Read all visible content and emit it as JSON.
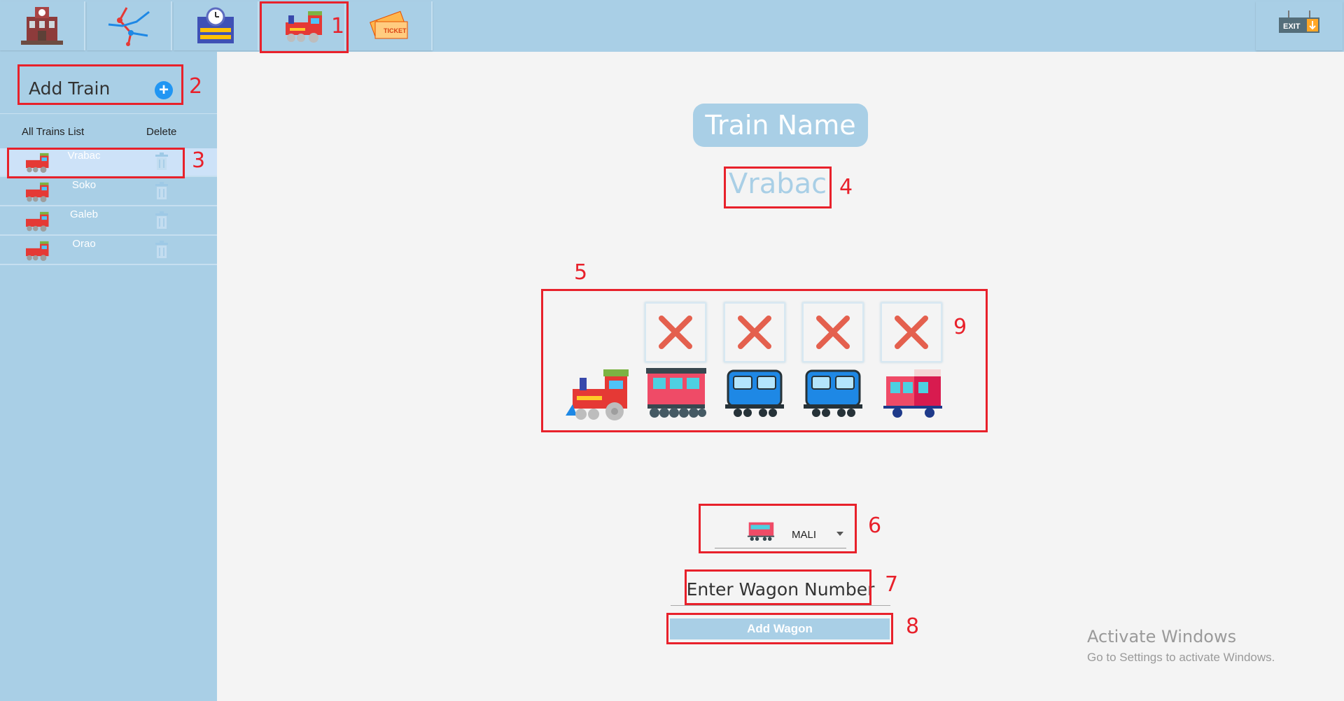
{
  "nav": {
    "tabs": [
      {
        "name": "station",
        "icon": "train-station-icon"
      },
      {
        "name": "lines",
        "icon": "route-map-icon"
      },
      {
        "name": "timetable",
        "icon": "timetable-clock-icon"
      },
      {
        "name": "trains",
        "icon": "locomotive-icon",
        "selected": true
      },
      {
        "name": "tickets",
        "icon": "ticket-icon"
      }
    ],
    "exit_label": "EXIT"
  },
  "sidebar": {
    "add_train_label": "Add Train",
    "list_header": "All Trains List",
    "delete_header": "Delete",
    "trains": [
      {
        "name": "Vrabac",
        "selected": true
      },
      {
        "name": "Soko"
      },
      {
        "name": "Galeb"
      },
      {
        "name": "Orao"
      }
    ]
  },
  "main": {
    "title": "Train Name",
    "train_name": "Vrabac",
    "composition": [
      {
        "type": "locomotive",
        "icon": "locomotive-icon"
      },
      {
        "type": "wagon",
        "icon": "red-passenger-wagon-icon",
        "remove_icon": "remove-x-icon"
      },
      {
        "type": "wagon",
        "icon": "blue-passenger-wagon-icon",
        "remove_icon": "remove-x-icon"
      },
      {
        "type": "wagon",
        "icon": "blue-passenger-wagon-icon",
        "remove_icon": "remove-x-icon"
      },
      {
        "type": "wagon",
        "icon": "small-red-wagon-icon",
        "remove_icon": "remove-x-icon"
      }
    ],
    "wagon_type_select": {
      "selected": "MALI",
      "icon": "small-red-wagon-icon"
    },
    "wagon_number_placeholder": "Enter Wagon Number",
    "add_wagon_label": "Add Wagon"
  },
  "annotations": [
    "1",
    "2",
    "3",
    "4",
    "5",
    "6",
    "7",
    "8",
    "9"
  ],
  "watermark": {
    "title": "Activate Windows",
    "subtitle": "Go to Settings to activate Windows."
  },
  "colors": {
    "accent": "#a9cfe6",
    "annotation": "#e8212b",
    "background": "#f4f4f4",
    "add_icon": "#2196f3"
  }
}
